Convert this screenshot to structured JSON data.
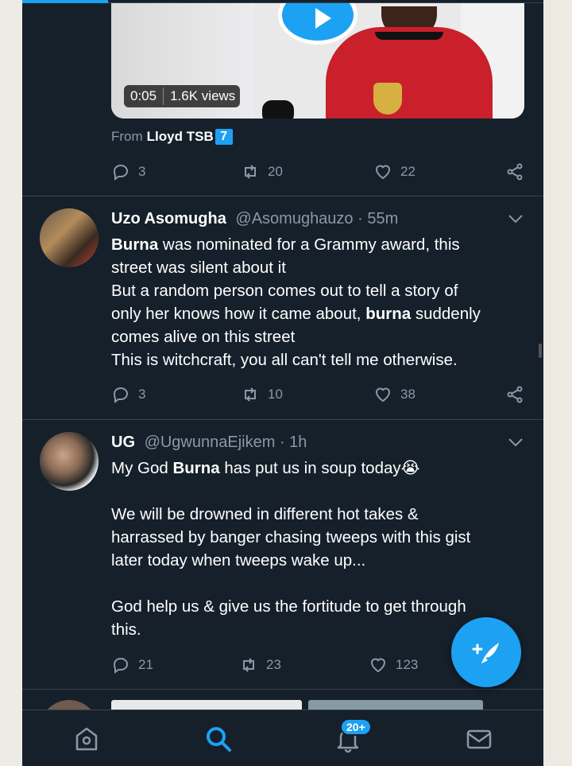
{
  "colors": {
    "background": "#15202b",
    "accent": "#1da1f2",
    "text": "#ffffff",
    "muted": "#8899a6",
    "divider": "#38444d"
  },
  "video_tweet": {
    "duration": "0:05",
    "views": "1.6K views",
    "from_label": "From",
    "from_name": "Lloyd TSB",
    "from_badge": "7",
    "replies": "3",
    "retweets": "20",
    "likes": "22"
  },
  "tweets": [
    {
      "name": "Uzo Asomugha",
      "handle": "@Asomughauzo",
      "time": "· 55m",
      "lines": [
        {
          "bold": "Burna",
          "rest": " was nominated for a Grammy award, this"
        },
        {
          "text": "street was silent about it"
        },
        {
          "text": "But a random person comes out to tell a story of"
        },
        {
          "pre": "only her knows how it came about, ",
          "bold": "burna",
          "rest": " suddenly"
        },
        {
          "text": "comes alive on this street"
        },
        {
          "text": "This is witchcraft, you all can't tell me otherwise."
        }
      ],
      "replies": "3",
      "retweets": "10",
      "likes": "38"
    },
    {
      "name": "UG",
      "handle": "@UgwunnaEjikem",
      "time": "· 1h",
      "line1_pre": "My God ",
      "line1_bold": "Burna",
      "line1_rest": " has put us in soup today😭",
      "para2": [
        "We will be drowned in different hot takes &",
        "harrassed by banger chasing tweeps with this gist",
        "later today when tweeps wake up..."
      ],
      "para3": [
        "God help us & give us the fortitude to get through",
        "this."
      ],
      "replies": "21",
      "retweets": "23",
      "likes": "123"
    }
  ],
  "nav": {
    "notifications_badge": "20+",
    "items": [
      "home-icon",
      "search-icon",
      "bell-icon",
      "mail-icon"
    ]
  },
  "fab": {
    "icon": "compose-feather-icon"
  }
}
